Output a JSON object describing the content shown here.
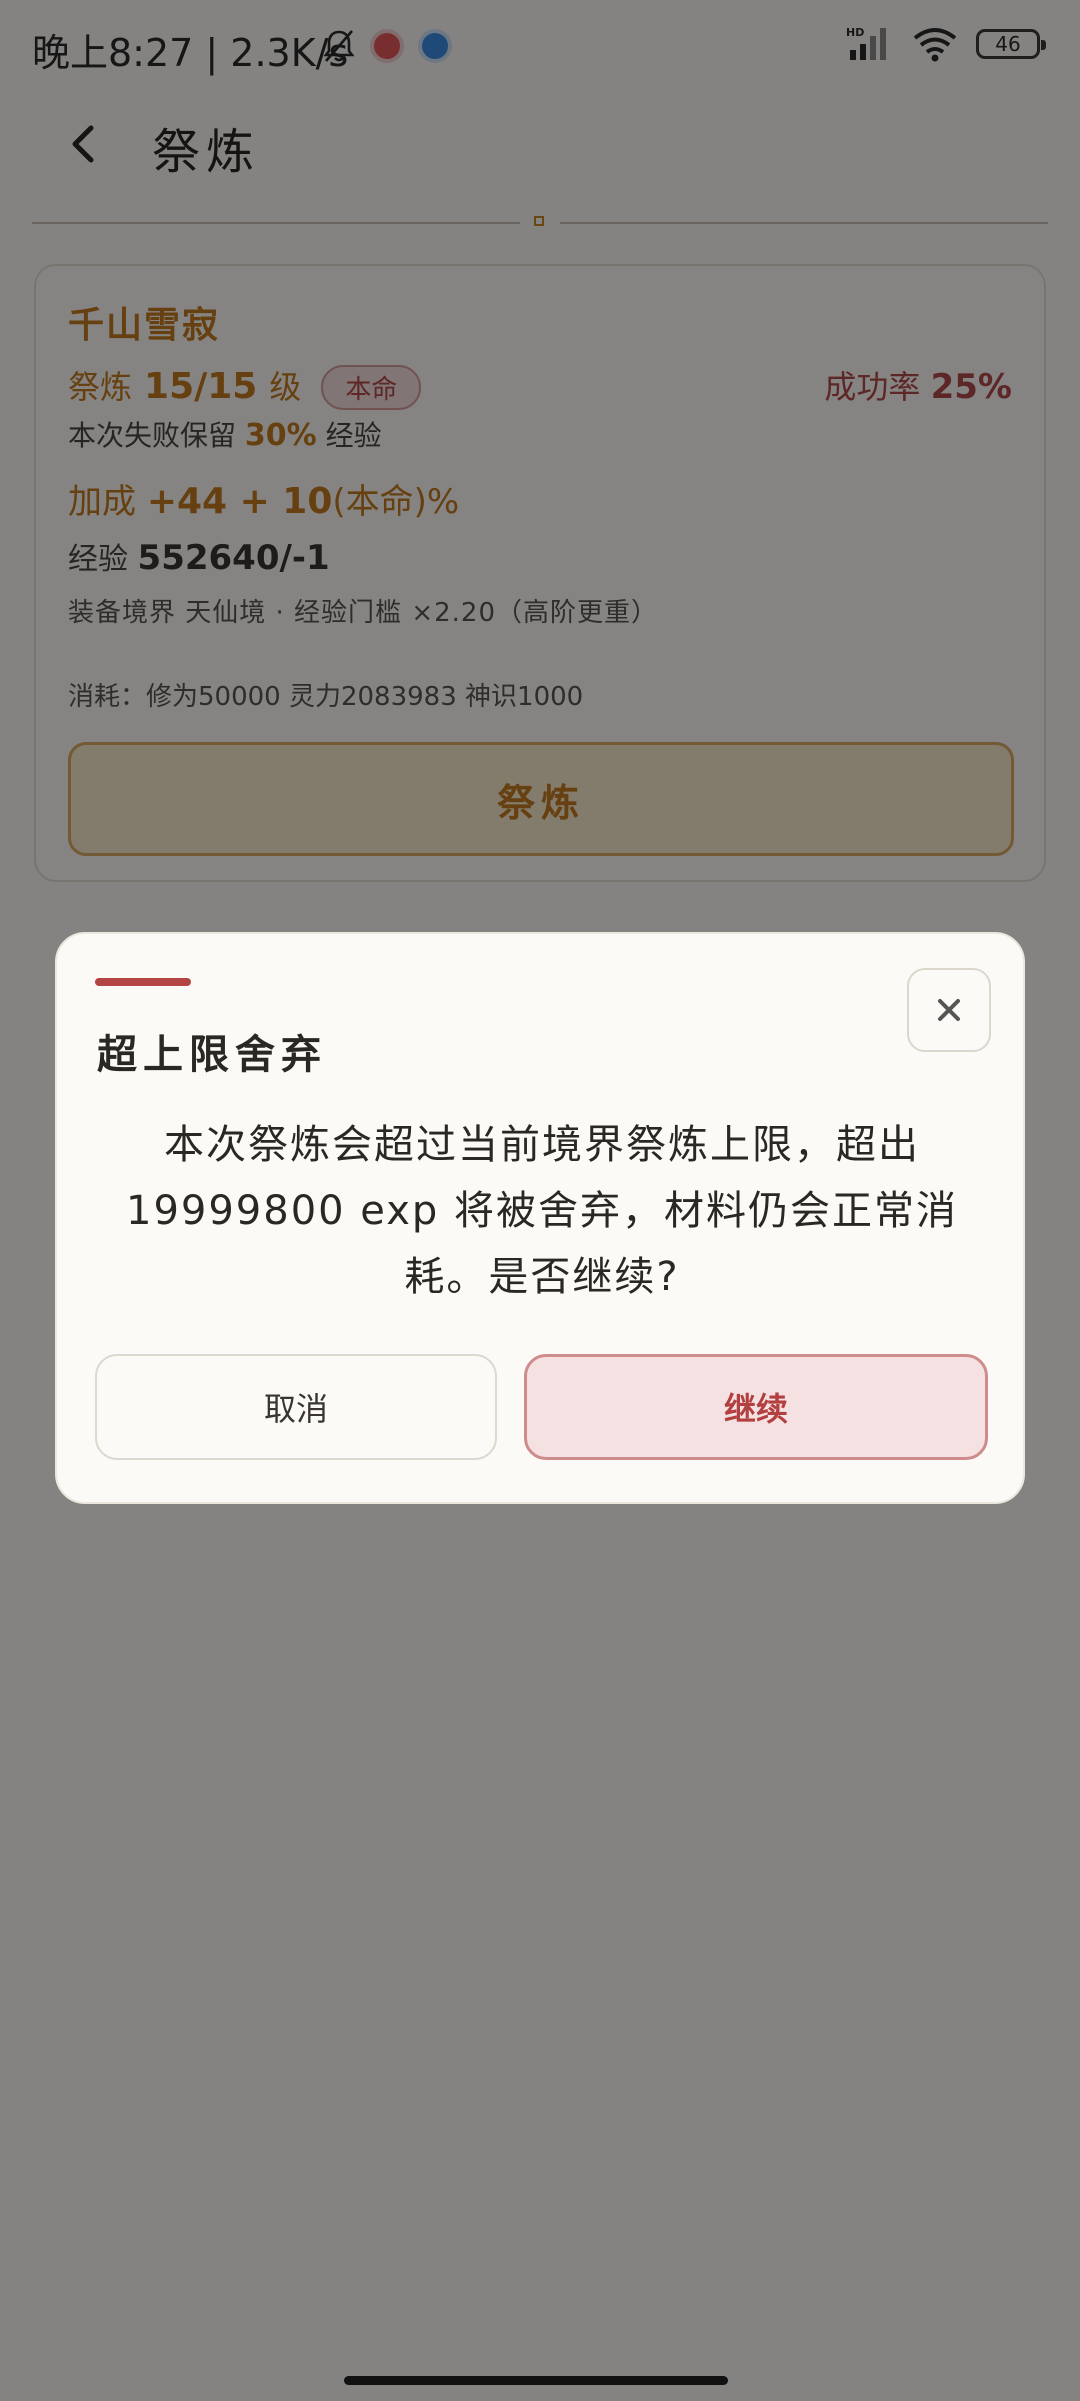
{
  "status_bar": {
    "time": "晚上8:27 | 2.3K/s",
    "battery": "46",
    "network_label": "HD"
  },
  "header": {
    "title": "祭炼"
  },
  "item": {
    "name": "千山雪寂",
    "level_label": "祭炼",
    "level_value": "15/15",
    "level_unit": "级",
    "badge": "本命",
    "success_label": "成功率",
    "success_value": "25%",
    "fail_keep_prefix": "本次失败保留",
    "fail_keep_pct": "30%",
    "fail_keep_suffix": "经验",
    "bonus_label": "加成",
    "bonus_value": "+44 + 10",
    "bonus_suffix": "(本命)%",
    "exp_label": "经验",
    "exp_value": "552640/-1",
    "realm_text": "装备境界 天仙境 · 经验门槛 ×2.20（高阶更重）",
    "cost_text": "消耗：修为50000 灵力2083983 神识1000",
    "refine_button": "祭炼"
  },
  "dialog": {
    "title": "超上限舍弃",
    "message": "本次祭炼会超过当前境界祭炼上限，超出 19999800 exp 将被舍弃，材料仍会正常消耗。是否继续?",
    "cancel_label": "取消",
    "continue_label": "继续"
  },
  "colors": {
    "accent_gold": "#c07a1f",
    "accent_red": "#b44545",
    "overlay": "rgba(0,0,0,0.47)"
  }
}
